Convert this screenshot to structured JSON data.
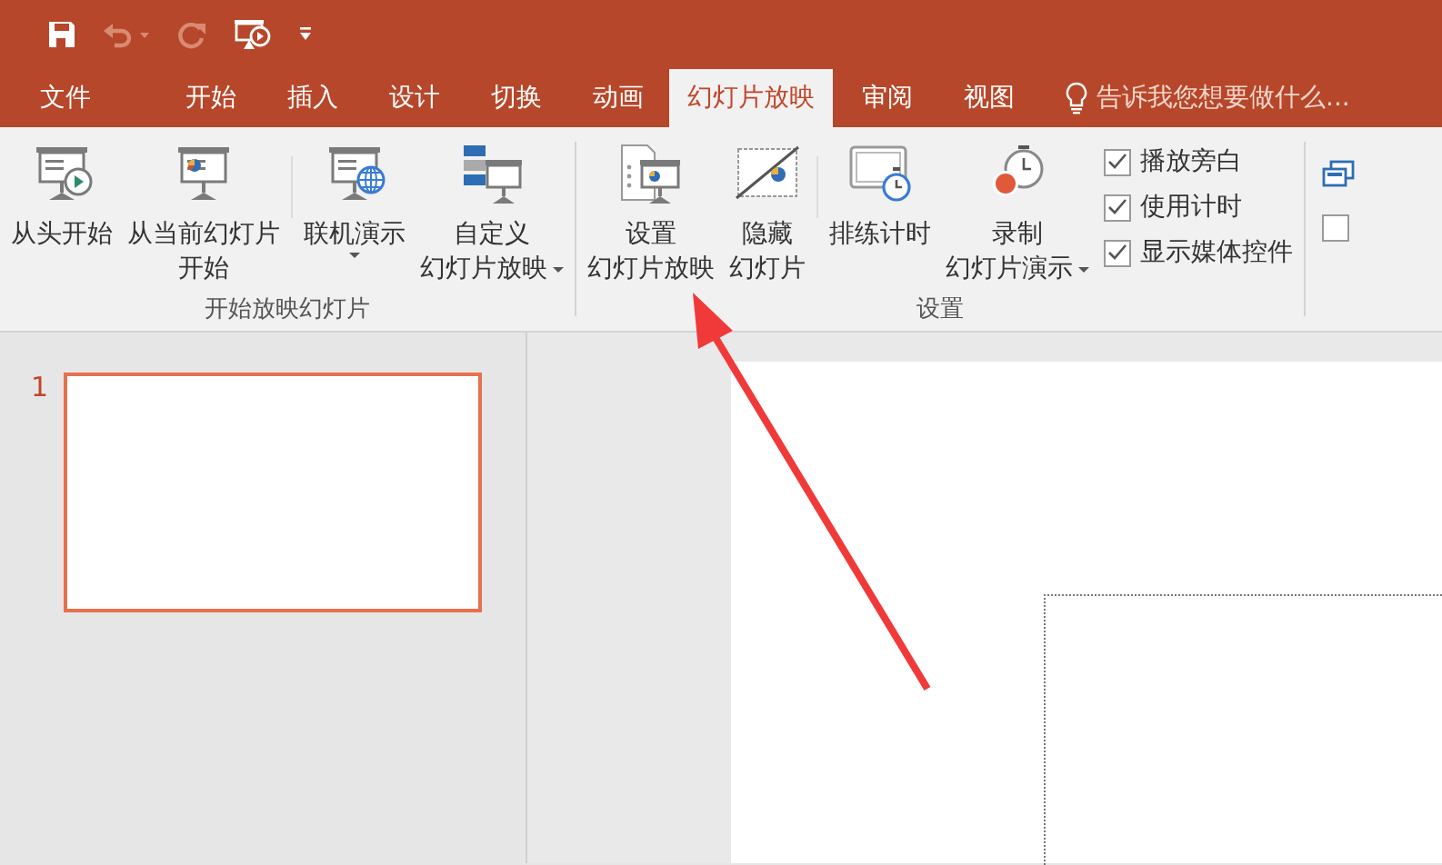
{
  "tabs": [
    {
      "label": "文件",
      "selected": false
    },
    {
      "label": "开始",
      "selected": false
    },
    {
      "label": "插入",
      "selected": false
    },
    {
      "label": "设计",
      "selected": false
    },
    {
      "label": "切换",
      "selected": false
    },
    {
      "label": "动画",
      "selected": false
    },
    {
      "label": "幻灯片放映",
      "selected": true
    },
    {
      "label": "审阅",
      "selected": false
    },
    {
      "label": "视图",
      "selected": false
    }
  ],
  "tell_me": {
    "placeholder": "告诉我您想要做什么..."
  },
  "ribbon_groups": [
    {
      "label": "开始放映幻灯片",
      "buttons": [
        {
          "lines": [
            "从头开始"
          ],
          "dropdown": false
        },
        {
          "lines": [
            "从当前幻灯片",
            "开始"
          ],
          "dropdown": false
        },
        {
          "lines": [
            "联机演示"
          ],
          "dropdown": true
        },
        {
          "lines": [
            "自定义",
            "幻灯片放映"
          ],
          "dropdown": true
        }
      ]
    },
    {
      "label": "设置",
      "buttons": [
        {
          "lines": [
            "设置",
            "幻灯片放映"
          ],
          "dropdown": false
        },
        {
          "lines": [
            "隐藏",
            "幻灯片"
          ],
          "dropdown": false
        },
        {
          "lines": [
            "排练计时"
          ],
          "dropdown": false
        },
        {
          "lines": [
            "录制",
            "幻灯片演示"
          ],
          "dropdown": true
        }
      ],
      "checkboxes": [
        {
          "label": "播放旁白",
          "checked": true
        },
        {
          "label": "使用计时",
          "checked": true
        },
        {
          "label": "显示媒体控件",
          "checked": true
        }
      ]
    }
  ],
  "cut_group": {
    "checkbox": {
      "checked": false
    }
  },
  "slides": [
    {
      "number": "1",
      "selected": true
    }
  ]
}
